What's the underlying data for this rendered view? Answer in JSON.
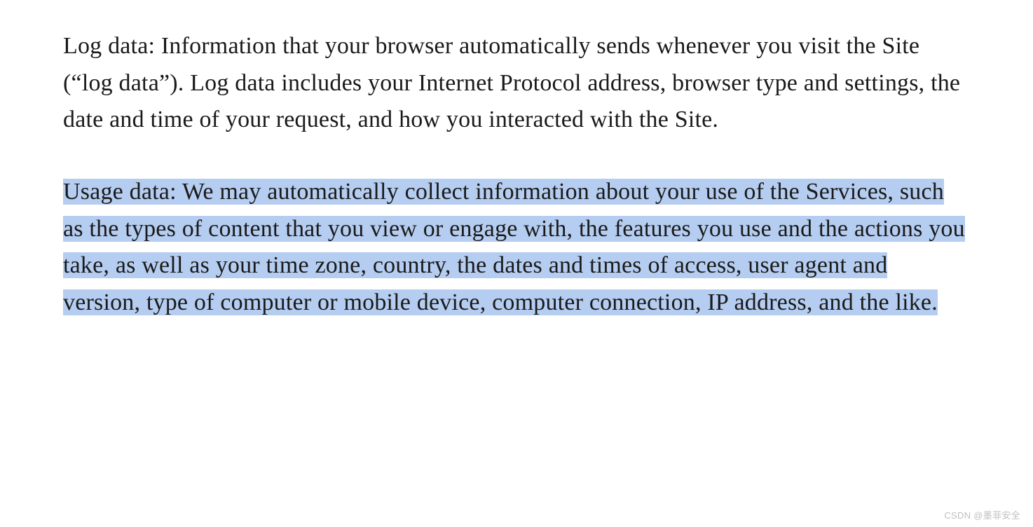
{
  "document": {
    "paragraph1": "Log data: Information that your browser automatically sends whenever you visit the Site (“log data”). Log data includes your Internet Protocol address, browser type and settings, the date and time of your request, and how you interacted with the Site.",
    "paragraph2": "Usage data: We may automatically collect information about your use of the Services, such as the types of content that you view or engage with, the features you use and the actions you take, as well as your time zone, country, the dates and times of access, user agent and version, type of computer or mobile device, computer connection, IP address, and the like."
  },
  "watermark": "CSDN @墨菲安全"
}
